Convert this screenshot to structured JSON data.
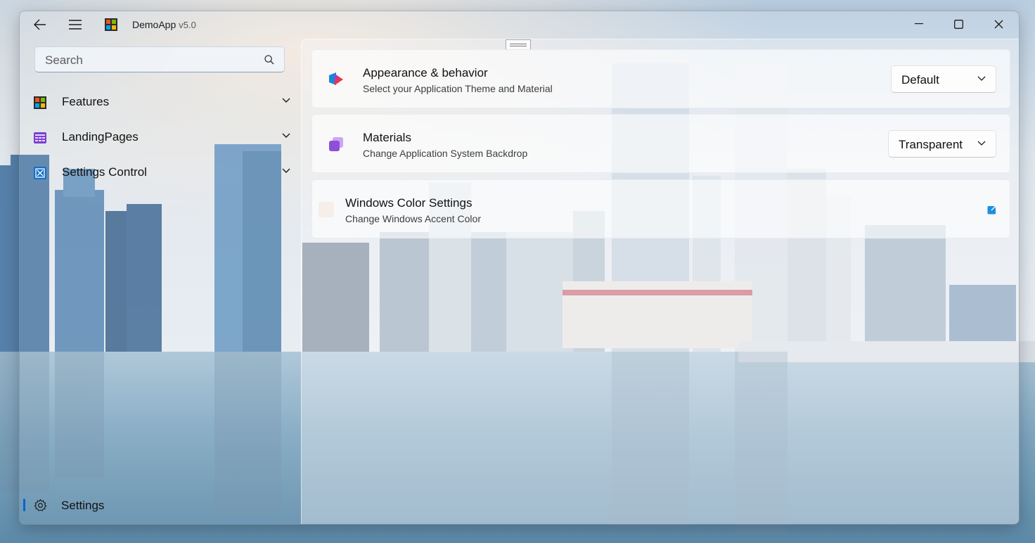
{
  "app": {
    "title": "DemoApp",
    "version": "v5.0"
  },
  "titlebar": {
    "back_icon": "arrow-left-icon",
    "menu_icon": "hamburger-icon",
    "min_icon": "minimize-icon",
    "max_icon": "maximize-icon",
    "close_icon": "close-icon"
  },
  "search": {
    "placeholder": "Search",
    "value": ""
  },
  "nav": {
    "items": [
      {
        "label": "Features",
        "icon": "features-icon"
      },
      {
        "label": "LandingPages",
        "icon": "landing-pages-icon"
      },
      {
        "label": "Settings Control",
        "icon": "settings-control-icon"
      }
    ],
    "footer": {
      "label": "Settings",
      "icon": "gear-icon"
    }
  },
  "cards": [
    {
      "title": "Appearance & behavior",
      "subtitle": "Select your Application Theme and Material",
      "dropdown_value": "Default"
    },
    {
      "title": "Materials",
      "subtitle": "Change Application System Backdrop",
      "dropdown_value": "Transparent"
    },
    {
      "title": "Windows Color Settings",
      "subtitle": "Change Windows Accent Color",
      "action_icon": "open-external-icon"
    }
  ],
  "colors": {
    "accent": "#0a64c8",
    "link_icon": "#1a8fe0"
  }
}
